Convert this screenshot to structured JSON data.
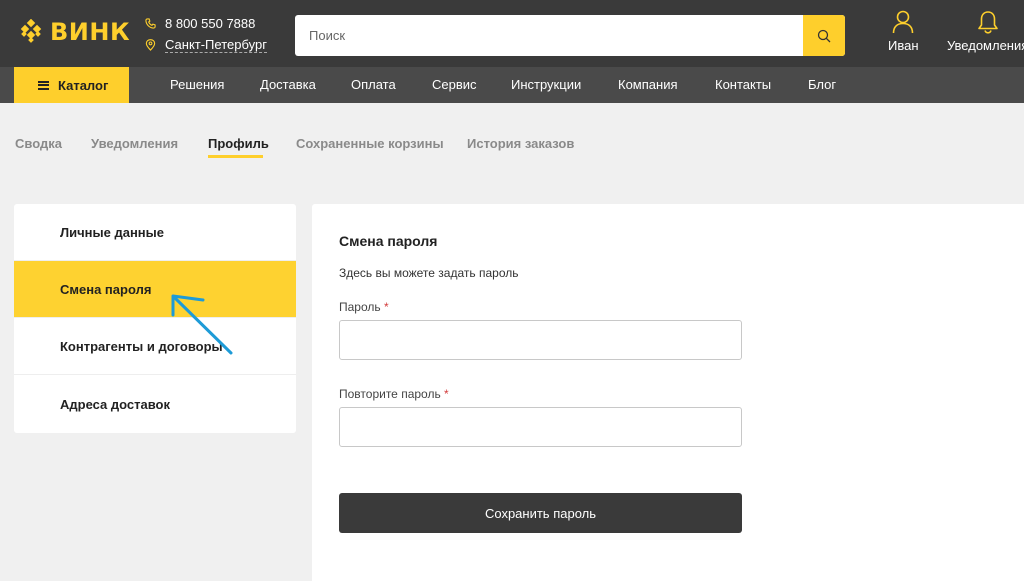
{
  "header": {
    "logo_text": "ВИНК",
    "phone": "8 800 550 7888",
    "city": "Санкт-Петербург",
    "search_placeholder": "Поиск",
    "user_label": "Иван",
    "notifications_label": "Уведомления"
  },
  "nav": {
    "catalog_label": "Каталог",
    "items": [
      "Решения",
      "Доставка",
      "Оплата",
      "Сервис",
      "Инструкции",
      "Компания",
      "Контакты",
      "Блог"
    ]
  },
  "tabs": [
    "Сводка",
    "Уведомления",
    "Профиль",
    "Сохраненные корзины",
    "История заказов"
  ],
  "active_tab": "Профиль",
  "side_menu": {
    "items": [
      "Личные данные",
      "Смена пароля",
      "Контрагенты и договоры",
      "Адреса доставок"
    ],
    "active": "Смена пароля"
  },
  "form": {
    "title": "Смена пароля",
    "description": "Здесь вы можете задать пароль",
    "password_label": "Пароль",
    "repeat_label": "Повторите пароль",
    "required_mark": "*",
    "save_label": "Сохранить пароль"
  },
  "colors": {
    "accent": "#fecf2c",
    "header_bg": "#3a3a3a",
    "nav_bg": "#4a4a4a",
    "annotation_arrow": "#1e9bd7"
  },
  "icons": {
    "logo": "logo-diamond-icon",
    "phone": "phone-icon",
    "location": "location-pin-icon",
    "search": "search-icon",
    "user": "user-icon",
    "bell": "bell-icon",
    "menu": "hamburger-icon"
  }
}
